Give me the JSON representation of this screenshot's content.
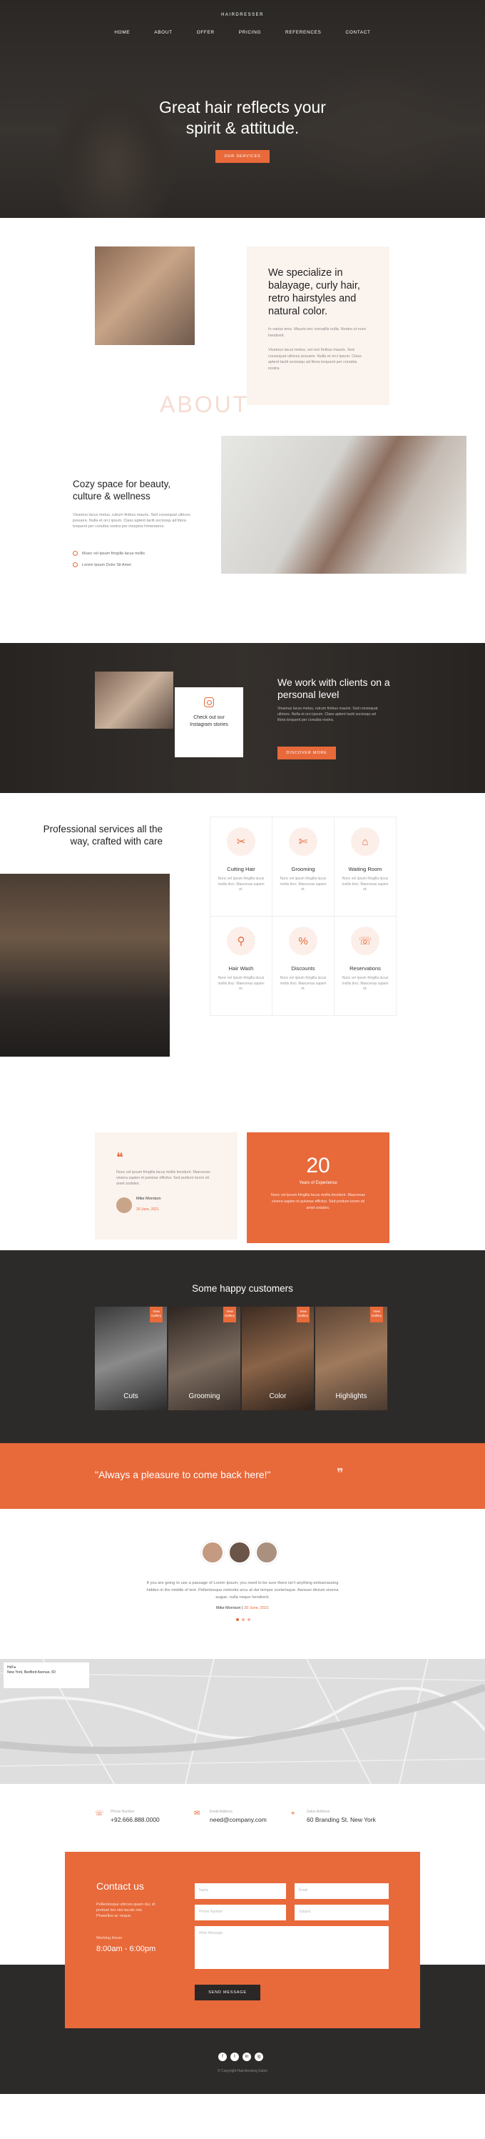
{
  "brand": {
    "name": "HAIRDRESSER"
  },
  "nav": {
    "items": [
      "HOME",
      "ABOUT",
      "OFFER",
      "PRICING",
      "REFERENCES",
      "CONTACT"
    ]
  },
  "hero": {
    "title_line1": "Great hair reflects your",
    "title_line2": "spirit & attitude.",
    "button": "OUR SERVICES"
  },
  "about": {
    "watermark": "ABOUT",
    "title": "We specialize in balayage, curly hair, retro hairstyles and natural color.",
    "p1": "In varius eros. Mauris nec convallis nulla. Nostra ut nunc hendrerit.",
    "p2": "Vivamus lacus metus, vel orci finibus mauris. Sed consequat ultrices posuere. Nulla et orci ipsum. Class aptent taciti sociosqu ad litora torquent per conubia nostra."
  },
  "cozy": {
    "title": "Cozy space for beauty, culture & wellness",
    "text": "Vivamus lacus metus, rutrum finibus mauris. Sed consequat ultrices posuere. Nulla et orci ipsum. Class aptent taciti sociosqu ad litora torquent per conubia nostra per inceptos himenaeos.",
    "items": [
      "Music vel ipsum fringilla lacus mollis",
      "Lorem Ipsum Dolor Sit Amet"
    ]
  },
  "personal": {
    "instagram": "Check out our Instagram stories",
    "title": "We work with clients on a personal level",
    "text": "Vivamus lacus metus, rutrum finibus mauris. Sed consequat ultrices. Nulla et orci ipsum. Class aptent taciti sociosqu ad litora torquent per conubia nostra.",
    "button": "DISCOVER MORE"
  },
  "services": {
    "title": "Professional services all the way, crafted with care",
    "items": [
      {
        "name": "Cutting Hair",
        "icon": "scissors-icon",
        "glyph": "✂",
        "desc": "Nunc vel ipsum fringilla lacus mollis tinci. Maecenas sapien et."
      },
      {
        "name": "Grooming",
        "icon": "comb-scissors-icon",
        "glyph": "✄",
        "desc": "Nunc vel ipsum fringilla lacus mollis tinci. Maecenas sapien et."
      },
      {
        "name": "Waiting Room",
        "icon": "armchair-icon",
        "glyph": "⌂",
        "desc": "Nunc vel ipsum fringilla lacus mollis tinci. Maecenas sapien et."
      },
      {
        "name": "Hair Wash",
        "icon": "sink-icon",
        "glyph": "⚲",
        "desc": "Nunc vel ipsum fringilla lacus mollis tinci. Maecenas sapien et."
      },
      {
        "name": "Discounts",
        "icon": "percent-icon",
        "glyph": "%",
        "desc": "Nunc vel ipsum fringilla lacus mollis tinci. Maecenas sapien et."
      },
      {
        "name": "Reservations",
        "icon": "phone-icon",
        "glyph": "☏",
        "desc": "Nunc vel ipsum fringilla lacus mollis tinci. Maecenas sapien et."
      }
    ]
  },
  "testimonial": {
    "text": "Nunc vel ipsum fringilla lacus mollis tincidunt. Maecenas viverra sapien et pulvinar efficitur. Sed pretium lorem sit amet sodales.",
    "author": "Mike Morrison",
    "date": "20 June, 2021"
  },
  "stat": {
    "number": "20",
    "label": "Years of Experience",
    "text": "Nunc vel ipsum fringilla lacus mollis tincidunt. Maecenas viverra sapien et pulvinar efficitur. Sed pretium lorem sit amet sodales."
  },
  "customers": {
    "title": "Some happy customers",
    "items": [
      {
        "label": "Cuts",
        "tag": "View Gallery"
      },
      {
        "label": "Grooming",
        "tag": "View Gallery"
      },
      {
        "label": "Color",
        "tag": "View Gallery"
      },
      {
        "label": "Highlights",
        "tag": "View Gallery"
      }
    ]
  },
  "banner": {
    "quote": "\"Always a pleasure to come back here!\""
  },
  "review": {
    "text": "If you are going to use a passage of Lorem Ipsum, you need to be sure there isn't anything embarrassing hidden in the middle of text. Pellentesque molestie arcu at dui tempor scelerisque. Aenean dictum viverra augue, nulla neque hendrerit.",
    "author": "Mike Morrison",
    "date": "20 June, 2021"
  },
  "map": {
    "place": "Hell ▸",
    "address": "New York, Bedford Avenue, 60"
  },
  "contact_info": [
    {
      "label": "Phone Number",
      "value": "+92.666.888.0000",
      "icon": "phone-icon",
      "glyph": "☏"
    },
    {
      "label": "Email Address",
      "value": "need@company.com",
      "icon": "mail-icon",
      "glyph": "✉"
    },
    {
      "label": "Salon Address",
      "value": "60 Branding St. New York",
      "icon": "map-pin-icon",
      "glyph": "⌖"
    }
  ],
  "contact": {
    "title": "Contact us",
    "text": "Pellentesque ultrices quam dui, id pretium leo nisi iaculis nisi. Phasellus ac neque.",
    "hours_label": "Working Hours",
    "hours": "8:00am - 6:00pm",
    "fields": {
      "name": "Name",
      "email": "Email",
      "phone": "Phone Number",
      "subject": "Subject",
      "message": "Write Message"
    },
    "button": "SEND MESSAGE"
  },
  "footer": {
    "social": [
      "f",
      "t",
      "in",
      "ig"
    ],
    "copy": "© Copyright Hairdressing Salon"
  },
  "colors": {
    "accent": "#e8693a",
    "dark": "#2d2b2a",
    "cream": "#fbf3ee"
  }
}
